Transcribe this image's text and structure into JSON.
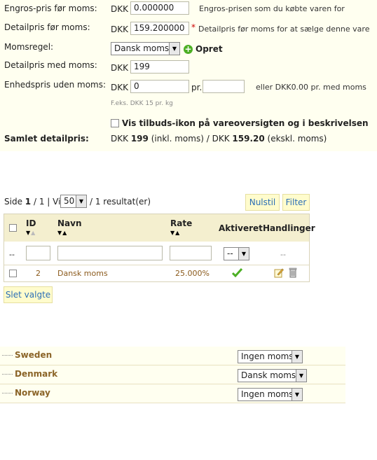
{
  "pricing": {
    "wholesale": {
      "label": "Engros-pris før moms:",
      "currency": "DKK",
      "value": "0.000000",
      "hint": "Engros-prisen som du købte varen for"
    },
    "retail_excl": {
      "label": "Detailpris før moms:",
      "currency": "DKK",
      "value": "159.200000",
      "required": "*",
      "hint": "Detailpris før moms for at sælge denne vare"
    },
    "tax_rule": {
      "label": "Momsregel:",
      "selected": "Dansk moms",
      "create_label": "Opret"
    },
    "retail_incl": {
      "label": "Detailpris med moms:",
      "currency": "DKK",
      "value": "199"
    },
    "unit_price": {
      "label": "Enhedspris uden moms:",
      "currency": "DKK",
      "value": "0",
      "per": "pr.",
      "unit_value": "",
      "hint": "eller DKK0.00 pr. med moms",
      "example": "F.eks. DKK 15 pr. kg"
    },
    "on_sale": {
      "label": "Vis tilbuds-ikon på vareoversigten og i beskrivelsen"
    },
    "total": {
      "label": "Samlet detailpris:",
      "currency1": "DKK",
      "incl_value": "199",
      "incl_text": "(inkl. moms) /",
      "currency2": "DKK",
      "excl_value": "159.20",
      "excl_text": "(ekskl. moms)"
    }
  },
  "listing": {
    "page_prefix": "Side",
    "page_current": "1",
    "page_sep": "/ 1 | Vis",
    "per_page": "50",
    "result_text": "/ 1 resultat(er)",
    "reset_label": "Nulstil",
    "filter_label": "Filter",
    "columns": {
      "id": "ID",
      "name": "Navn",
      "rate": "Rate",
      "enabled": "Aktiveret",
      "actions": "Handlinger"
    },
    "filters": {
      "empty": "--",
      "enabled": "--",
      "actions": "--"
    },
    "rows": [
      {
        "id": "2",
        "name": "Dansk moms",
        "rate": "25.000%"
      }
    ],
    "delete_selected": "Slet valgte"
  },
  "zones": [
    {
      "country": "Sweden",
      "tax": "Ingen moms"
    },
    {
      "country": "Denmark",
      "tax": "Dansk moms"
    },
    {
      "country": "Norway",
      "tax": "Ingen moms"
    }
  ],
  "colors": {
    "panel_bg": "#fffff0",
    "link": "#2b6fb6",
    "name_brown": "#8b5a1c",
    "check_green": "#4caf24",
    "required_red": "#cc0000"
  }
}
